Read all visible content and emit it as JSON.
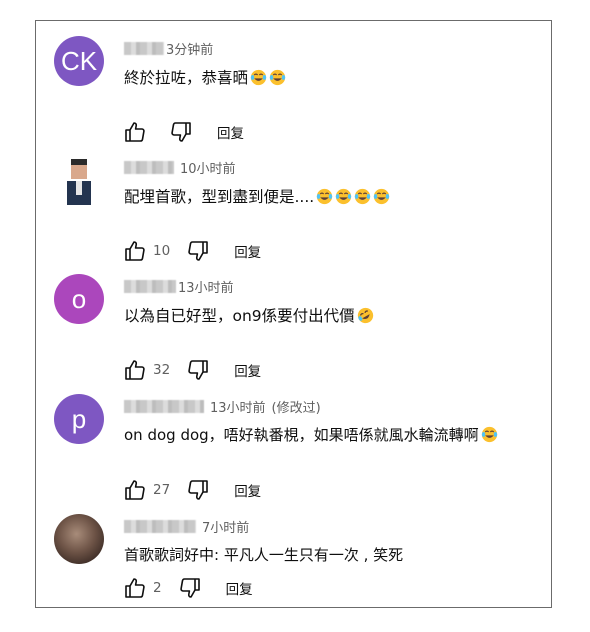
{
  "comments": [
    {
      "avatar_letter": "CK",
      "avatar_color": "#7e57c2",
      "time": "3分钟前",
      "edited": "",
      "text": "終於拉咗，恭喜晒",
      "emojis": [
        "laughing-tears",
        "laughing-tears"
      ],
      "likes": "",
      "reply_label": "回复"
    },
    {
      "avatar_letter": "",
      "avatar_color": "",
      "time": "10小时前",
      "edited": "",
      "text": "配埋首歌，型到盡到便是....",
      "emojis": [
        "laughing-tears",
        "laughing-tears",
        "laughing-tears",
        "laughing-tears"
      ],
      "likes": "10",
      "reply_label": "回复"
    },
    {
      "avatar_letter": "o",
      "avatar_color": "#ab47bc",
      "time": "13小时前",
      "edited": "",
      "text": "以為自已好型，on9係要付出代價",
      "emojis": [
        "rolling-laughing"
      ],
      "likes": "32",
      "reply_label": "回复"
    },
    {
      "avatar_letter": "p",
      "avatar_color": "#7e57c2",
      "time": "13小时前",
      "edited": "(修改过)",
      "text": "on dog dog，唔好執番梘，如果唔係就風水輪流轉啊",
      "emojis": [
        "laughing-tears"
      ],
      "likes": "27",
      "reply_label": "回复"
    },
    {
      "avatar_letter": "",
      "avatar_color": "",
      "time": "7小时前",
      "edited": "",
      "text": "首歌歌詞好中: 平凡人一生只有一次 , 笑死",
      "emojis": [],
      "likes": "2",
      "reply_label": "回复"
    }
  ]
}
